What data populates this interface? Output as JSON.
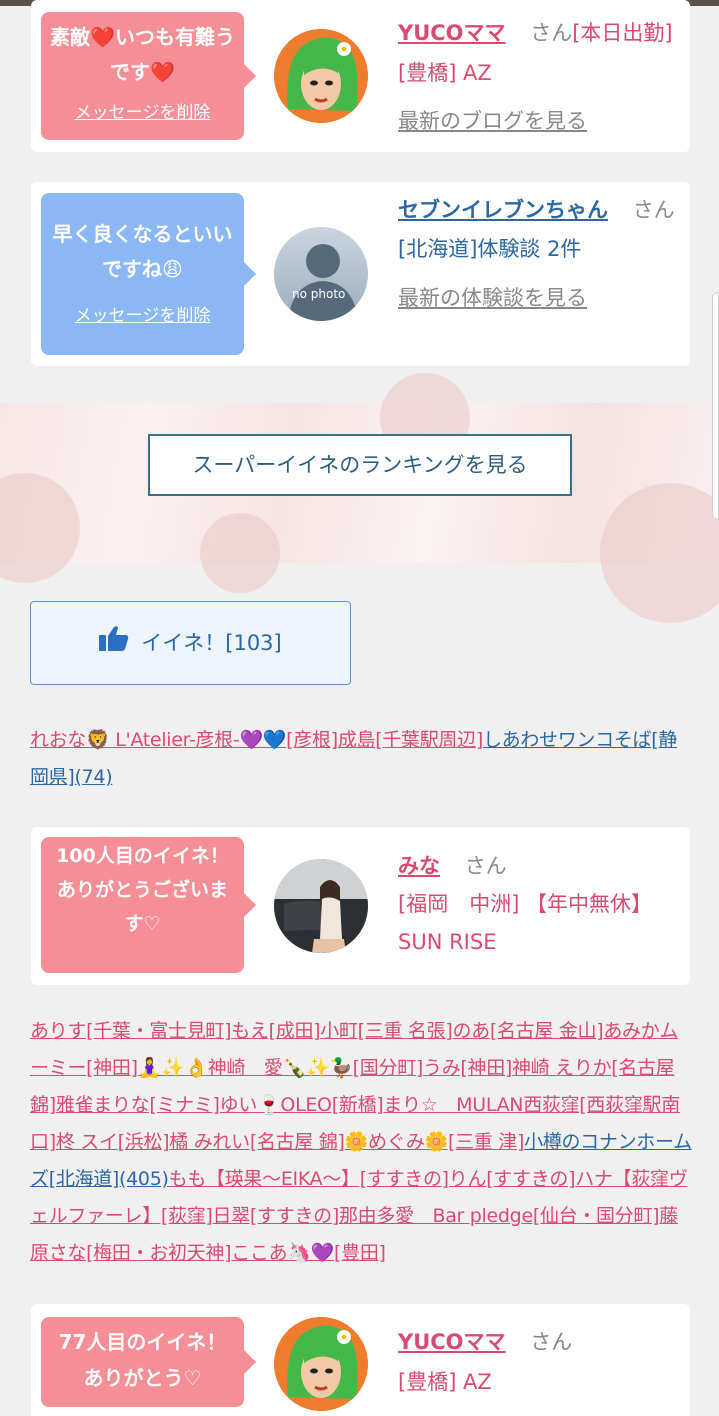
{
  "cards": [
    {
      "bubble_text": "素敵❤️いつも有難うです❤️",
      "delete_label": "メッセージを削除",
      "name": "YUCOママ",
      "san": "さん",
      "status": "[本日出勤]",
      "area_shop": "[豊橋] AZ",
      "link": "最新のブログを見る"
    },
    {
      "bubble_text": "早く良くなるといいですね😩",
      "delete_label": "メッセージを削除",
      "name": "セブンイレブンちゃん",
      "san": "さん",
      "area_count": "[北海道]体験談 2件",
      "link": "最新の体験談を見る",
      "avatar_text": "no photo"
    },
    {
      "bubble_text": "100人目のイイネ！ありがとうございます♡",
      "name": "みな",
      "san": "さん",
      "area_shop": "[福岡　中洲] 【年中無休】SUN RISE"
    },
    {
      "bubble_text": "77人目のイイネ！ありがとう♡",
      "name": "YUCOママ",
      "san": "さん",
      "area_shop": "[豊橋] AZ"
    }
  ],
  "ranking_button": "スーパーイイネのランキングを見る",
  "iine_button": "イイネ！[103]",
  "likers_line1": [
    {
      "text": "れおな🦁 L'Atelier-彦根-💜💙[彦根]",
      "color": "pink"
    },
    {
      "text": "成島[千葉駅周辺]",
      "color": "pink"
    },
    {
      "text": "しあわせワンコそば[静岡県](74)",
      "color": "blue"
    }
  ],
  "likers_line2": [
    {
      "text": "ありす[千葉・富士見町]",
      "color": "pink"
    },
    {
      "text": "もえ[成田]",
      "color": "pink"
    },
    {
      "text": "小町[三重 名張]",
      "color": "pink"
    },
    {
      "text": "のあ[名古屋 金山]",
      "color": "pink"
    },
    {
      "text": "あみかムーミー[神田]",
      "color": "pink"
    },
    {
      "text": "🧘‍♀️✨👌神崎　愛🍾✨🦆[国分町]",
      "color": "pink"
    },
    {
      "text": "うみ[神田]",
      "color": "pink"
    },
    {
      "text": "神崎 えりか[名古屋 錦]",
      "color": "pink"
    },
    {
      "text": "雅雀まりな[ミナミ]",
      "color": "pink"
    },
    {
      "text": "ゆい🍷OLEO[新橋]",
      "color": "pink"
    },
    {
      "text": "まり☆　MULAN西荻窪[西荻窪駅南口]",
      "color": "pink"
    },
    {
      "text": "柊 スイ[浜松]",
      "color": "pink"
    },
    {
      "text": "橘 みれい[名古屋 錦]",
      "color": "pink"
    },
    {
      "text": "🌼めぐみ🌼[三重 津]",
      "color": "pink"
    },
    {
      "text": "小樽のコナンホームズ[北海道](405)",
      "color": "blue"
    },
    {
      "text": "もも【瑛果〜EIKA〜】[すすきの]",
      "color": "pink"
    },
    {
      "text": "りん[すすきの]",
      "color": "pink"
    },
    {
      "text": "ハナ【荻窪ヴェルファーレ】[荻窪]",
      "color": "pink"
    },
    {
      "text": "日翠[すすきの]",
      "color": "pink"
    },
    {
      "text": "那由多愛　Bar pledge[仙台・国分町]",
      "color": "pink"
    },
    {
      "text": "藤原さな[梅田・お初天神]",
      "color": "pink"
    },
    {
      "text": "ここあ🦄💜[豊田]",
      "color": "pink"
    }
  ],
  "colors": {
    "pink_bubble": "#f58e97",
    "blue_bubble": "#8bb7f4",
    "pink_text": "#d94a72",
    "blue_text": "#2b67a3"
  }
}
